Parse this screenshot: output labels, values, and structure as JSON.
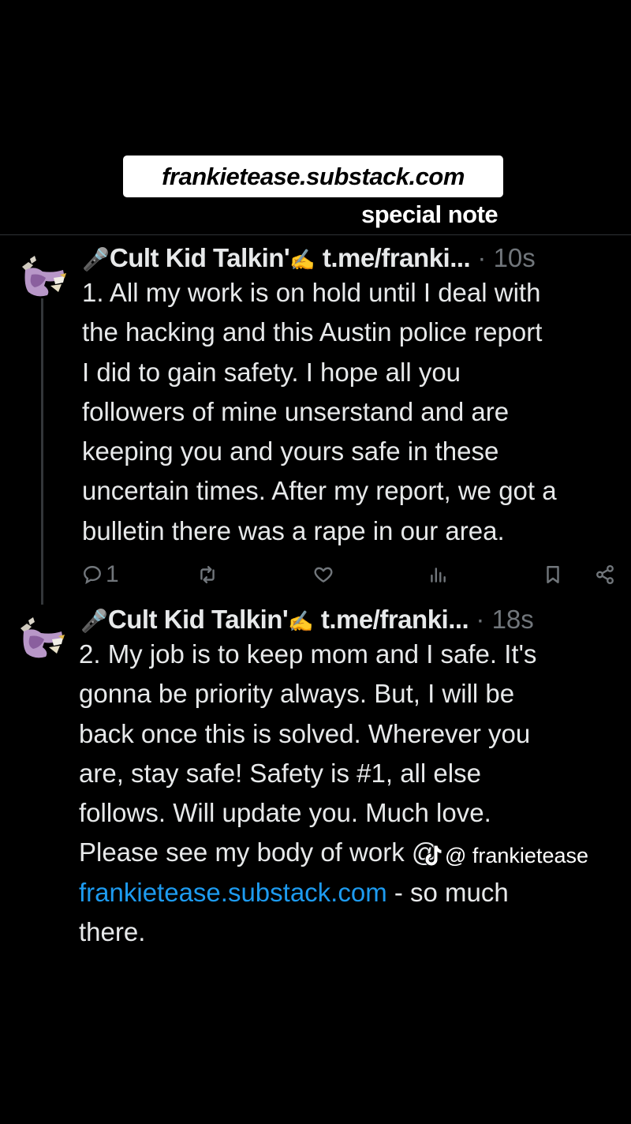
{
  "overlay": {
    "url_banner": "frankietease.substack.com",
    "special_note": "special note"
  },
  "tweets": [
    {
      "name": "Cult Kid Talkin'",
      "name_prefix_emoji": "🎤",
      "name_suffix_emoji": "✍",
      "handle": "t.me/franki...",
      "separator": "·",
      "time": "10s",
      "lines": [
        "1. All my work is on hold until I deal with",
        "the hacking and this Austin police report",
        "I did to gain safety. I hope all you",
        "followers of mine unserstand and are",
        "keeping you and yours safe in these",
        "uncertain times. After my report, we got a",
        "bulletin there was a rape in our area."
      ],
      "reply_count": "1"
    },
    {
      "name": "Cult Kid Talkin'",
      "name_prefix_emoji": "🎤",
      "name_suffix_emoji": "✍",
      "handle": "t.me/franki...",
      "separator": "·",
      "time": "18s",
      "lines": [
        "2. My job is to keep mom and I safe. It's",
        "gonna be priority always. But, I will be",
        "back once this is solved. Wherever you",
        "are, stay safe!  Safety is #1, all else",
        "follows. Will update you. Much love.",
        "Please see my body of work @"
      ],
      "link_text": "frankietease.substack.com",
      "after_link": " - so much",
      "last_line": "there."
    }
  ],
  "watermark": {
    "icon": "tiktok-icon",
    "text": "@ frankietease"
  },
  "colors": {
    "background": "#000000",
    "text": "#e7e9ea",
    "muted": "#71767b",
    "link": "#1d9bf0",
    "divider": "#2f3336"
  }
}
